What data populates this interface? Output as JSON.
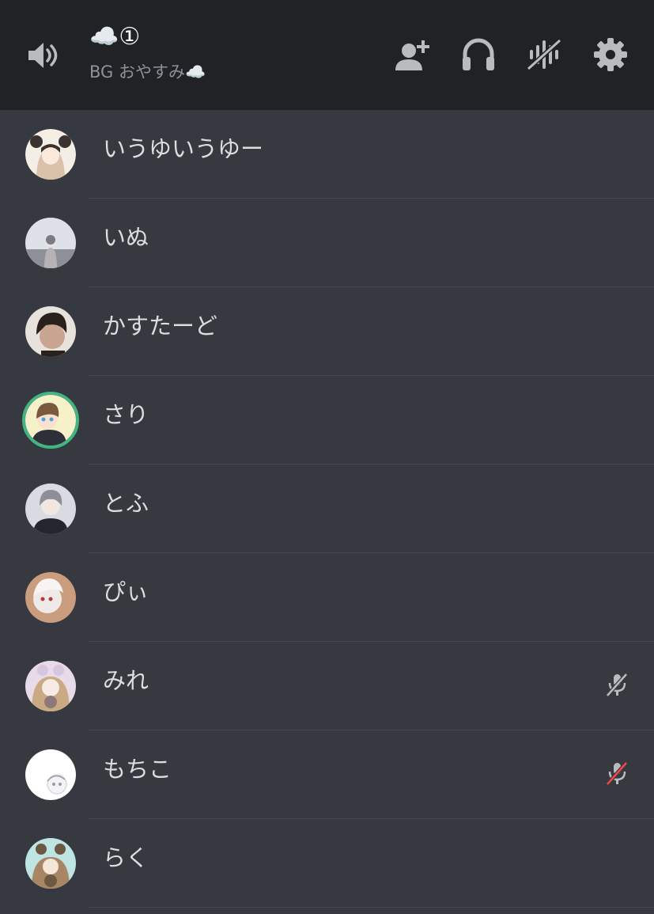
{
  "header": {
    "channel_title": "☁️①",
    "channel_status": "BG おやすみ☁️",
    "icons": [
      "speaker-icon",
      "add-user-icon",
      "headphones-icon",
      "voice-activity-icon",
      "gear-icon"
    ]
  },
  "members": [
    {
      "name": "いうゆいうゆー",
      "speaking": false,
      "mute": "none",
      "avatar_colors": [
        "#f4eee6",
        "#3b3330",
        "#d9c2a8"
      ]
    },
    {
      "name": "いぬ",
      "speaking": false,
      "mute": "none",
      "avatar_colors": [
        "#dfe1e8",
        "#b7b3b4",
        "#8d8f99"
      ]
    },
    {
      "name": "かすたーど",
      "speaking": false,
      "mute": "none",
      "avatar_colors": [
        "#e8e2dc",
        "#2a211d",
        "#c9a592"
      ]
    },
    {
      "name": "さり",
      "speaking": true,
      "mute": "none",
      "avatar_colors": [
        "#f6f1c9",
        "#7a5a3e",
        "#2d3038"
      ]
    },
    {
      "name": "とふ",
      "speaking": false,
      "mute": "none",
      "avatar_colors": [
        "#d9dbe2",
        "#8e8f96",
        "#23262e"
      ]
    },
    {
      "name": "ぴぃ",
      "speaking": false,
      "mute": "none",
      "avatar_colors": [
        "#c99d7e",
        "#efeae8",
        "#b43a3a"
      ]
    },
    {
      "name": "みれ",
      "speaking": false,
      "mute": "self",
      "avatar_colors": [
        "#e8dbe8",
        "#c9aa82",
        "#8a7b78"
      ]
    },
    {
      "name": "もちこ",
      "speaking": false,
      "mute": "server",
      "avatar_colors": [
        "#ffffff",
        "#d8d8dc",
        "#9a9aa3"
      ]
    },
    {
      "name": "らく",
      "speaking": false,
      "mute": "none",
      "avatar_colors": [
        "#bfe5e3",
        "#a88663",
        "#6d5846"
      ]
    }
  ],
  "colors": {
    "header_bg": "#202225",
    "list_bg": "#36393f",
    "speaking_ring": "#43b581",
    "muted_strike": "#f04747",
    "icon_gray": "#b9bbbe"
  }
}
